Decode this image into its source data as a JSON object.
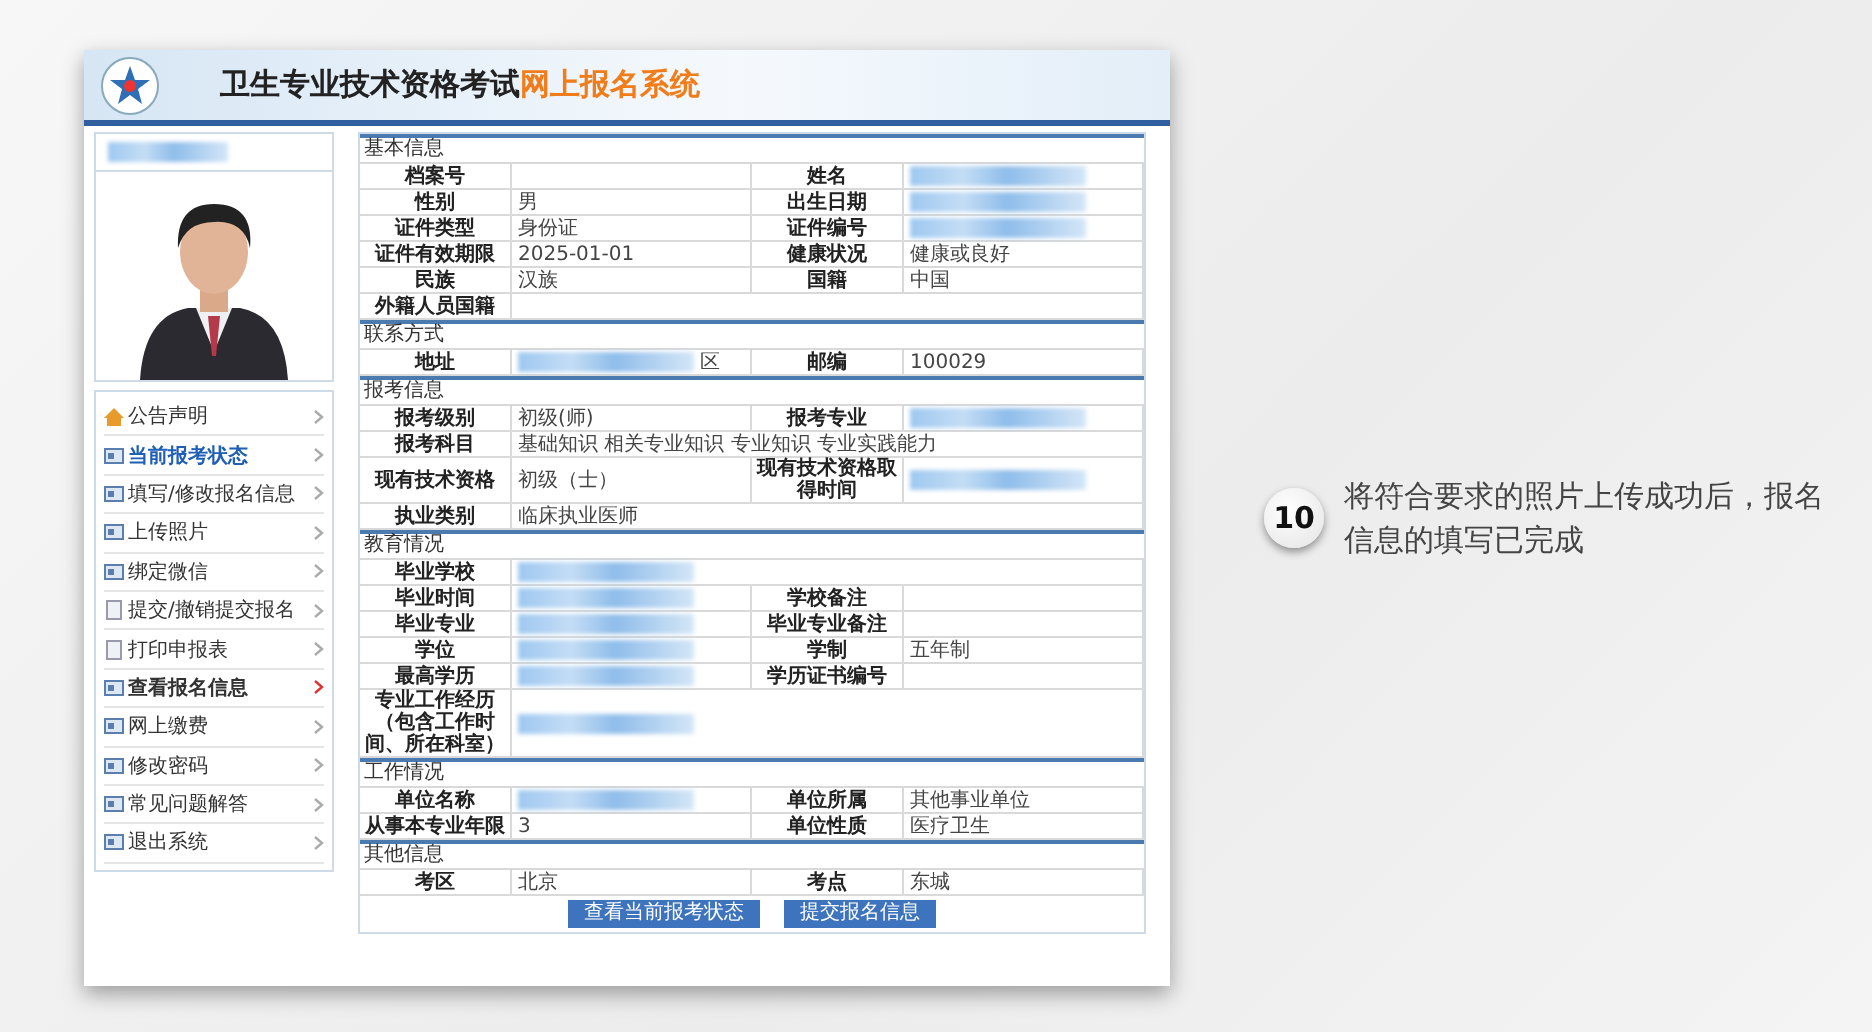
{
  "header": {
    "title": "卫生专业技术资格考试",
    "title_highlight": "网上报名系统"
  },
  "sidebar": {
    "user_name_redacted": true,
    "menu": [
      {
        "label": "公告声明",
        "kind": "home",
        "highlighted": false,
        "selected": false
      },
      {
        "label": "当前报考状态",
        "kind": "card",
        "highlighted": true,
        "selected": false
      },
      {
        "label": "填写/修改报名信息",
        "kind": "card",
        "highlighted": false,
        "selected": false
      },
      {
        "label": "上传照片",
        "kind": "card",
        "highlighted": false,
        "selected": false
      },
      {
        "label": "绑定微信",
        "kind": "card",
        "highlighted": false,
        "selected": false
      },
      {
        "label": "提交/撤销提交报名",
        "kind": "doc",
        "highlighted": false,
        "selected": false
      },
      {
        "label": "打印申报表",
        "kind": "doc",
        "highlighted": false,
        "selected": false
      },
      {
        "label": "查看报名信息",
        "kind": "card",
        "highlighted": false,
        "selected": true
      },
      {
        "label": "网上缴费",
        "kind": "card",
        "highlighted": false,
        "selected": false
      },
      {
        "label": "修改密码",
        "kind": "card",
        "highlighted": false,
        "selected": false
      },
      {
        "label": "常见问题解答",
        "kind": "card",
        "highlighted": false,
        "selected": false
      },
      {
        "label": "退出系统",
        "kind": "card",
        "highlighted": false,
        "selected": false
      }
    ]
  },
  "sections": [
    {
      "title": "基本信息",
      "rows": [
        [
          {
            "label": "档案号"
          },
          {
            "label": "姓名",
            "redacted": true
          }
        ],
        [
          {
            "label": "性别",
            "value": "男"
          },
          {
            "label": "出生日期",
            "redacted": true
          }
        ],
        [
          {
            "label": "证件类型",
            "value": "身份证"
          },
          {
            "label": "证件编号",
            "redacted": true
          }
        ],
        [
          {
            "label": "证件有效期限",
            "value": "2025-01-01"
          },
          {
            "label": "健康状况",
            "value": "健康或良好"
          }
        ],
        [
          {
            "label": "民族",
            "value": "汉族"
          },
          {
            "label": "国籍",
            "value": "中国"
          }
        ],
        [
          {
            "label": "外籍人员国籍"
          }
        ]
      ]
    },
    {
      "title": "联系方式",
      "rows": [
        [
          {
            "label": "地址",
            "value": "区",
            "redacted": true
          },
          {
            "label": "邮编",
            "value": "100029"
          }
        ]
      ]
    },
    {
      "title": "报考信息",
      "rows": [
        [
          {
            "label": "报考级别",
            "value": "初级(师)"
          },
          {
            "label": "报考专业",
            "redacted": true
          }
        ],
        [
          {
            "label": "报考科目",
            "value": "基础知识 相关专业知识 专业知识 专业实践能力"
          }
        ],
        [
          {
            "label": "现有技术资格",
            "value": "初级（士）"
          },
          {
            "label": "现有技术资格取得时间",
            "redacted": true
          }
        ],
        [
          {
            "label": "执业类别",
            "value": "临床执业医师"
          }
        ]
      ]
    },
    {
      "title": "教育情况",
      "rows": [
        [
          {
            "label": "毕业学校",
            "redacted": true
          }
        ],
        [
          {
            "label": "毕业时间",
            "redacted": true
          },
          {
            "label": "学校备注"
          }
        ],
        [
          {
            "label": "毕业专业",
            "redacted": true
          },
          {
            "label": "毕业专业备注"
          }
        ],
        [
          {
            "label": "学位",
            "redacted": true
          },
          {
            "label": "学制",
            "value": "五年制"
          }
        ],
        [
          {
            "label": "最高学历",
            "redacted": true
          },
          {
            "label": "学历证书编号"
          }
        ],
        [
          {
            "label": "专业工作经历（包含工作时间、所在科室）",
            "redacted": true
          }
        ]
      ]
    },
    {
      "title": "工作情况",
      "rows": [
        [
          {
            "label": "单位名称",
            "redacted": true
          },
          {
            "label": "单位所属",
            "value": "其他事业单位"
          }
        ],
        [
          {
            "label": "从事本专业年限",
            "value": "3"
          },
          {
            "label": "单位性质",
            "value": "医疗卫生"
          }
        ]
      ]
    },
    {
      "title": "其他信息",
      "rows": [
        [
          {
            "label": "考区",
            "value": "北京"
          },
          {
            "label": "考点",
            "value": "东城"
          }
        ]
      ]
    }
  ],
  "buttons": [
    "查看当前报考状态",
    "提交报名信息"
  ],
  "callout": {
    "step": "10",
    "text": "将符合要求的照片上传成功后，报名信息的填写已完成"
  }
}
